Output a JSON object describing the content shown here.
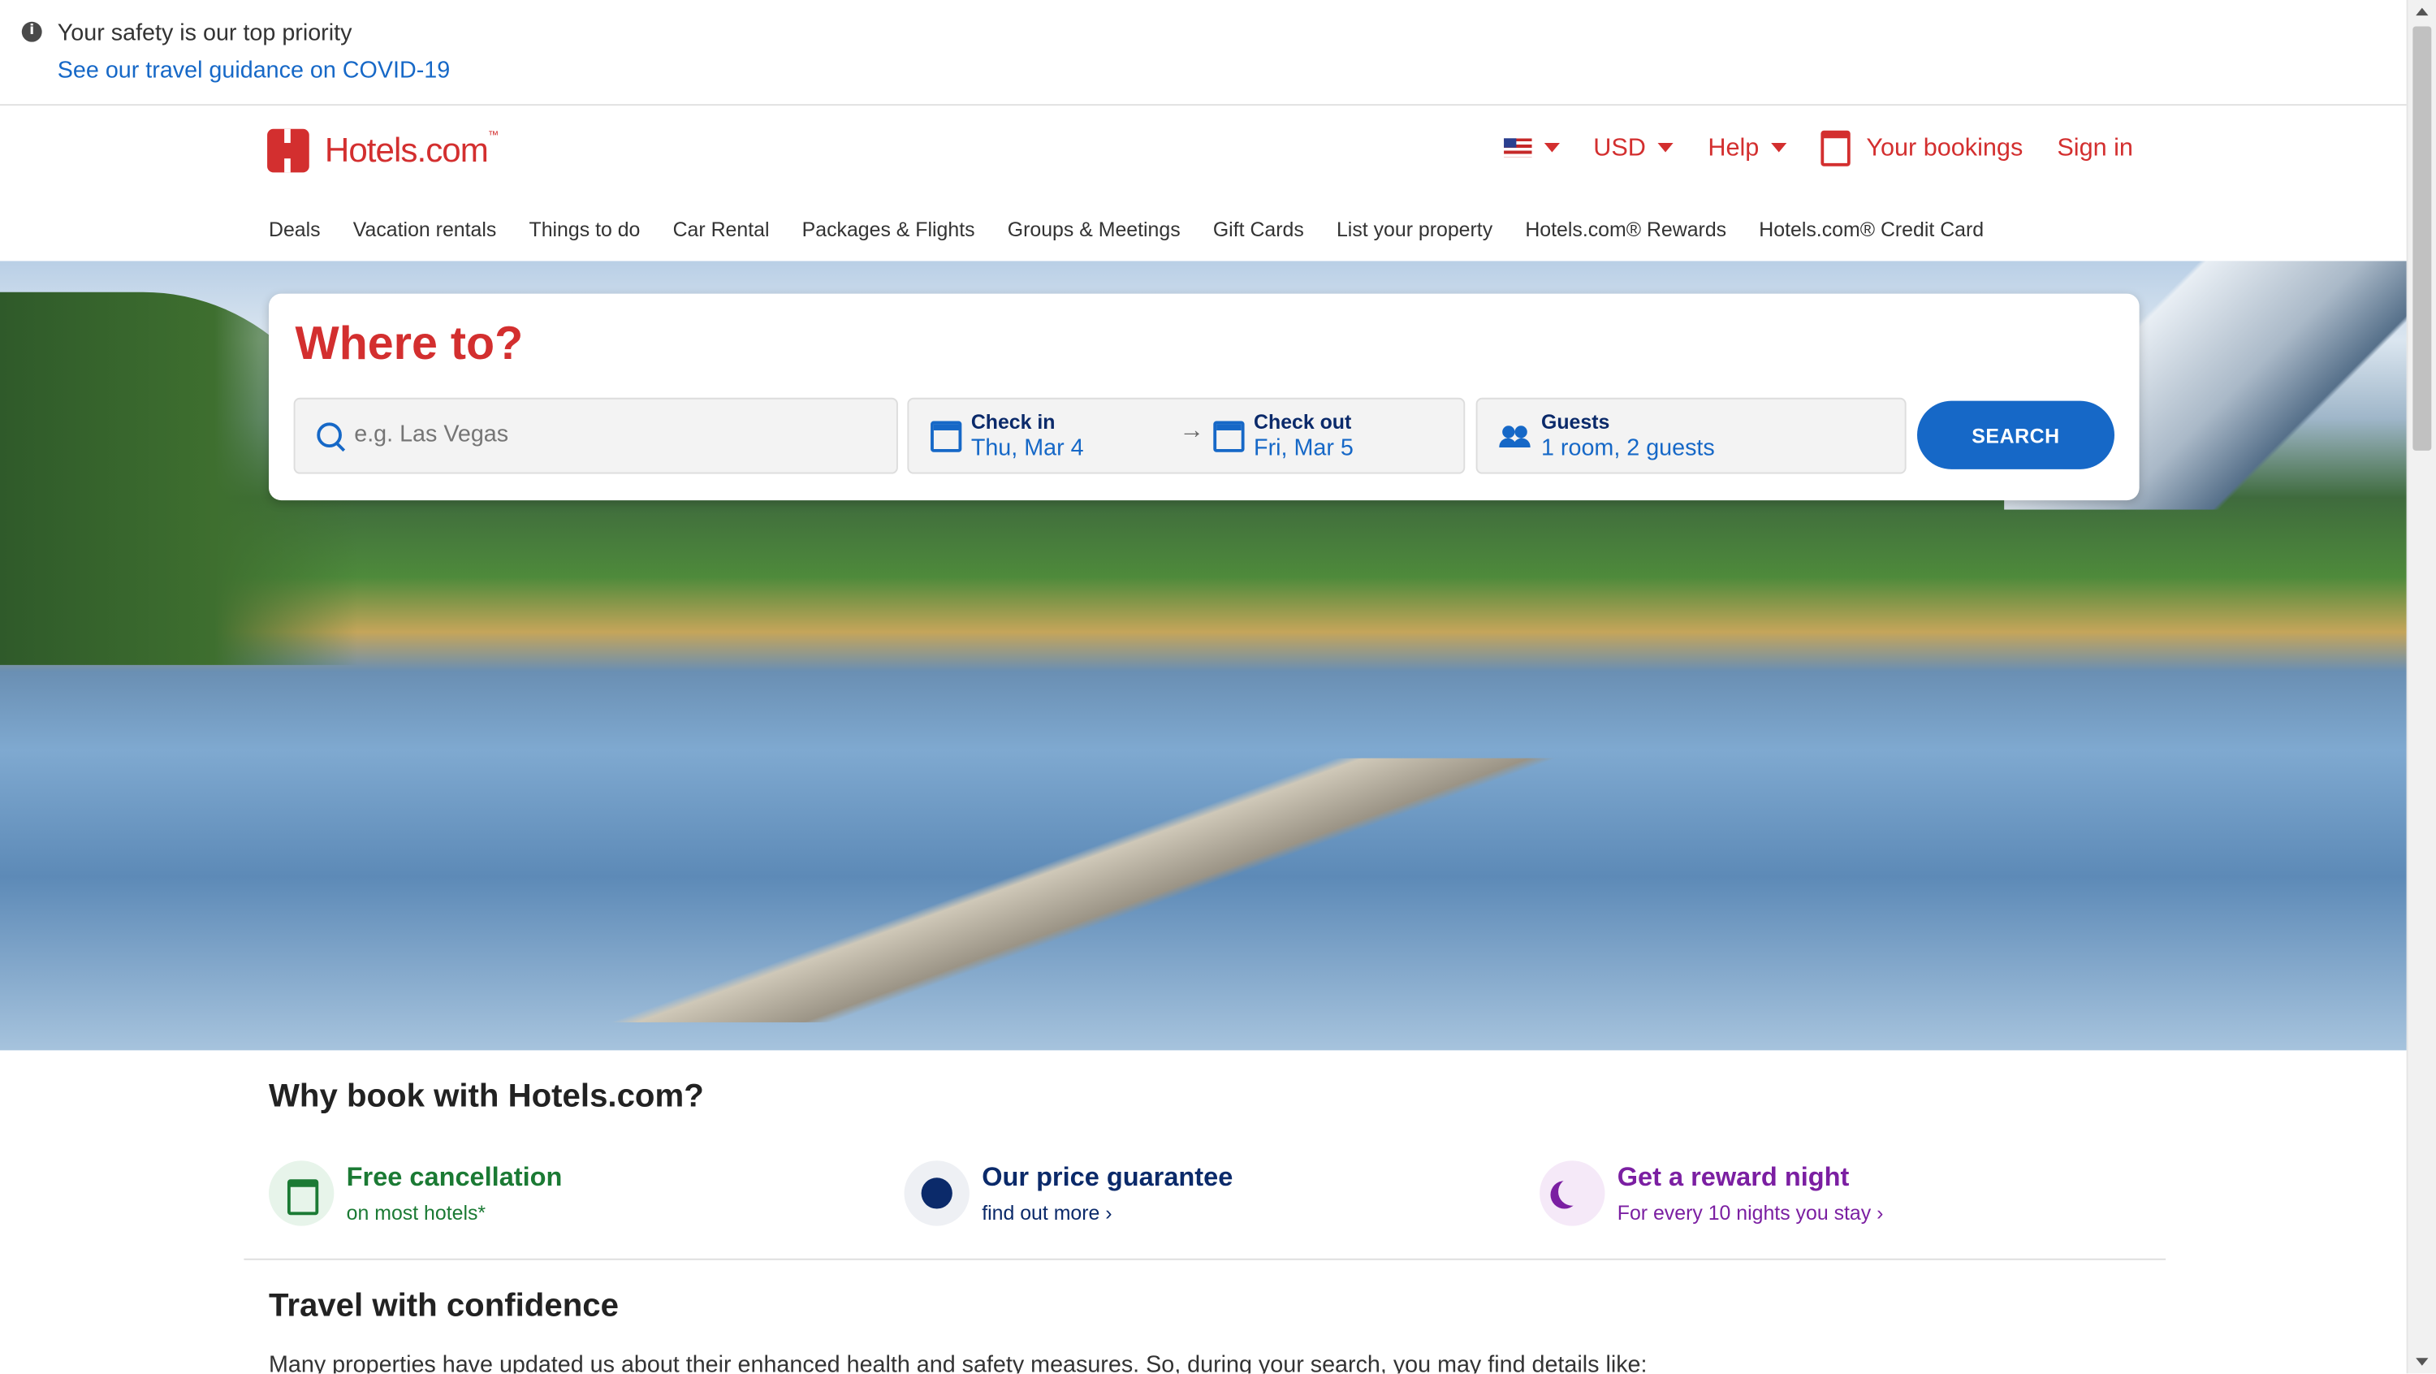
{
  "covid": {
    "title": "Your safety is our top priority",
    "link": "See our travel guidance on COVID-19"
  },
  "brand": {
    "name": "Hotels.com",
    "tm": "™"
  },
  "topbar": {
    "currency": "USD",
    "help": "Help",
    "bookings": "Your bookings",
    "signin": "Sign in"
  },
  "nav": [
    "Deals",
    "Vacation rentals",
    "Things to do",
    "Car Rental",
    "Packages & Flights",
    "Groups & Meetings",
    "Gift Cards",
    "List your property",
    "Hotels.com® Rewards",
    "Hotels.com® Credit Card"
  ],
  "search": {
    "heading": "Where to?",
    "dest_placeholder": "e.g. Las Vegas",
    "checkin_label": "Check in",
    "checkin_value": "Thu, Mar 4",
    "checkout_label": "Check out",
    "checkout_value": "Fri, Mar 5",
    "guests_label": "Guests",
    "guests_value": "1 room, 2 guests",
    "button": "SEARCH"
  },
  "why": {
    "title": "Why book with Hotels.com?",
    "features": [
      {
        "title": "Free cancellation",
        "sub": "on most hotels*"
      },
      {
        "title": "Our price guarantee",
        "sub": "find out more ›"
      },
      {
        "title": "Get a reward night",
        "sub": "For every 10 nights you stay ›"
      }
    ]
  },
  "confidence": {
    "title": "Travel with confidence",
    "text": "Many properties have updated us about their enhanced health and safety measures. So, during your search, you may find details like:"
  },
  "colors": {
    "brand_red": "#d32f2f",
    "link_blue": "#1668c7",
    "navy": "#0b2a6a",
    "green": "#1b7a34",
    "purple": "#7b1fa2"
  }
}
